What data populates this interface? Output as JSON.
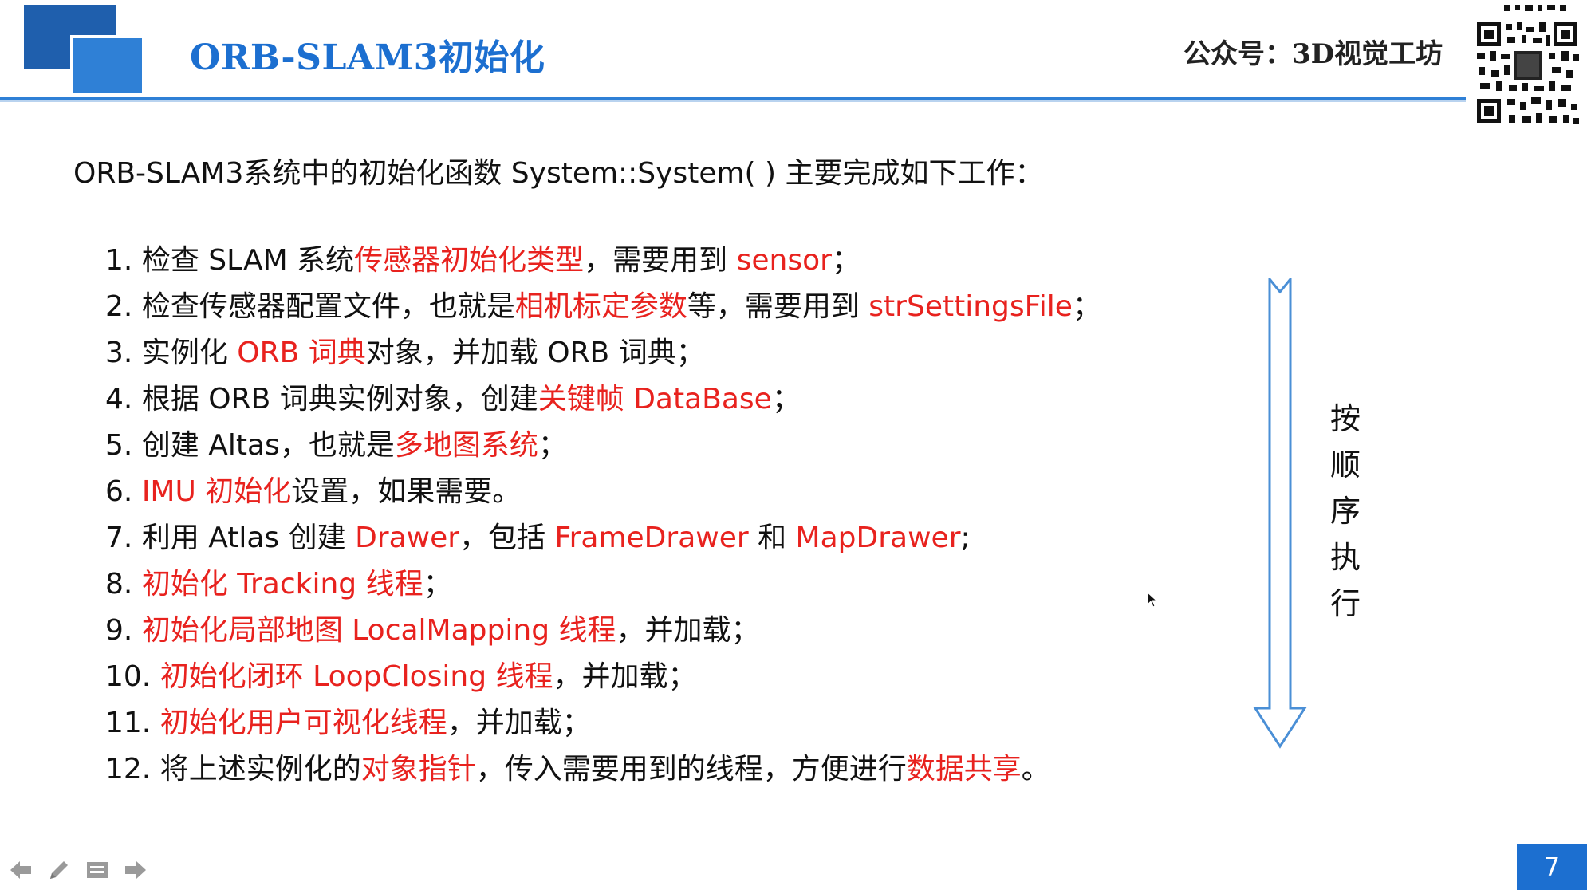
{
  "header": {
    "title": "ORB-SLAM3初始化",
    "brand": "公众号：3D视觉工坊",
    "qr_icon": "qr-code-icon"
  },
  "content": {
    "intro": "ORB-SLAM3系统中的初始化函数 System::System( ) 主要完成如下工作：",
    "steps": [
      {
        "num": "1.",
        "parts": [
          [
            "检查 SLAM 系统",
            false
          ],
          [
            "传感器初始化类型",
            true
          ],
          [
            "，需要用到 ",
            false
          ],
          [
            "sensor",
            true
          ],
          [
            "；",
            false
          ]
        ]
      },
      {
        "num": "2.",
        "parts": [
          [
            "检查传感器配置文件，也就是",
            false
          ],
          [
            "相机标定参数",
            true
          ],
          [
            "等，需要用到 ",
            false
          ],
          [
            "strSettingsFile",
            true
          ],
          [
            "；",
            false
          ]
        ]
      },
      {
        "num": "3.",
        "parts": [
          [
            "实例化 ",
            false
          ],
          [
            "ORB 词典",
            true
          ],
          [
            "对象，并加载 ORB 词典；",
            false
          ]
        ]
      },
      {
        "num": "4.",
        "parts": [
          [
            "根据 ORB 词典实例对象，创建",
            false
          ],
          [
            "关键帧 DataBase",
            true
          ],
          [
            "；",
            false
          ]
        ]
      },
      {
        "num": "5.",
        "parts": [
          [
            "创建 Altas，也就是",
            false
          ],
          [
            "多地图系统",
            true
          ],
          [
            "；",
            false
          ]
        ]
      },
      {
        "num": "6.",
        "parts": [
          [
            "IMU 初始化",
            true
          ],
          [
            "设置，如果需要。",
            false
          ]
        ]
      },
      {
        "num": "7.",
        "parts": [
          [
            "利用 Atlas 创建 ",
            false
          ],
          [
            "Drawer",
            true
          ],
          [
            "，包括 ",
            false
          ],
          [
            "FrameDrawer",
            true
          ],
          [
            " 和 ",
            false
          ],
          [
            "MapDrawer",
            true
          ],
          [
            ";",
            false
          ]
        ]
      },
      {
        "num": "8.",
        "parts": [
          [
            "初始化 Tracking 线程",
            true
          ],
          [
            "；",
            false
          ]
        ]
      },
      {
        "num": "9.",
        "parts": [
          [
            "初始化局部地图 LocalMapping 线程",
            true
          ],
          [
            "，并加载；",
            false
          ]
        ]
      },
      {
        "num": "10.",
        "parts": [
          [
            "初始化闭环 LoopClosing 线程",
            true
          ],
          [
            "，并加载；",
            false
          ]
        ]
      },
      {
        "num": "11.",
        "parts": [
          [
            "初始化用户可视化线程",
            true
          ],
          [
            "，并加载；",
            false
          ]
        ]
      },
      {
        "num": "12.",
        "parts": [
          [
            "将上述实例化的",
            false
          ],
          [
            "对象指针",
            true
          ],
          [
            "，传入需要用到的线程，方便进行",
            false
          ],
          [
            "数据共享",
            true
          ],
          [
            "。",
            false
          ]
        ]
      }
    ],
    "side_label": [
      "按",
      "顺",
      "序",
      "执",
      "行"
    ],
    "arrow_icon": "down-arrow-icon"
  },
  "footer": {
    "nav_icons": [
      "arrow-left-icon",
      "pen-icon",
      "menu-icon",
      "arrow-right-icon"
    ],
    "page_number": "7"
  },
  "colors": {
    "accent_blue": "#1c6fd0",
    "logo_dark": "#1f5fad",
    "logo_light": "#2f80d6",
    "highlight_red": "#e8221e",
    "text": "#111111"
  }
}
